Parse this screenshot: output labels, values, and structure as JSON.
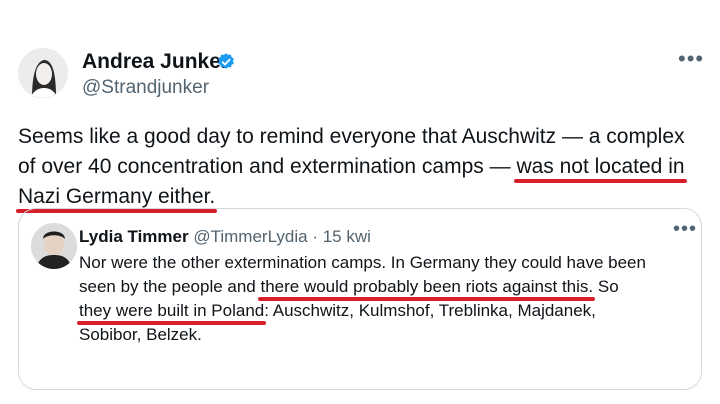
{
  "author": {
    "name": "Andrea Junker",
    "handle": "@Strandjunker",
    "verified": true,
    "badge_color": "#1d9bf0"
  },
  "tweet": {
    "line1": "Seems like a good day to remind everyone that Auschwitz — a complex",
    "line2_a": "of over 40 concentration and extermination camps — ",
    "line2_b": "was not located in",
    "line3": "Nazi Germany either."
  },
  "quoted": {
    "name": "Lydia Timmer",
    "handle": "@TimmerLydia",
    "separator": " · ",
    "time": "15 kwi",
    "line1": "Nor were the other extermination camps. In Germany they could have been",
    "line2_a": "seen by the people and ",
    "line2_b": "there would probably been riots against this.",
    "line2_c": " So",
    "line3_a": "they were built in Poland",
    "line3_b": ": Auschwitz, Kulmshof, Treblinka, Majdanek,",
    "line4": "Sobibor, Belzek."
  },
  "menu_icon": "•••",
  "colors": {
    "underline": "#d81e2a",
    "secondary_text": "#536471",
    "border": "#cfd9de"
  }
}
